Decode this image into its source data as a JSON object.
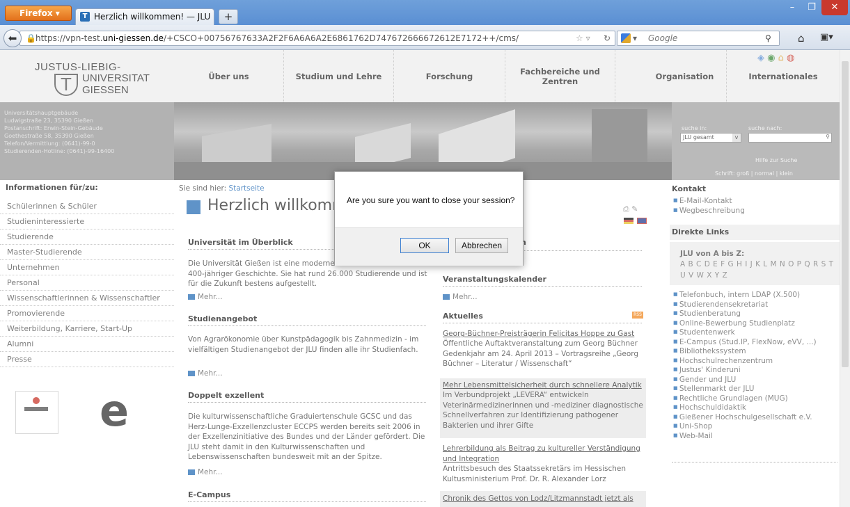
{
  "browser": {
    "menu_label": "Firefox",
    "tab_title": "Herzlich willkommen! — JLU",
    "new_tab": "+",
    "url_prefix": "https://vpn-test.",
    "url_domain": "uni-giessen.de",
    "url_rest": "/+CSCO+00756767633A2F2F6A6A6A2E6861762D747672666672612E7172++/cms/",
    "search_engine": "Google",
    "search_placeholder": "Google"
  },
  "site": {
    "logo_line1": "JUSTUS-LIEBIG-",
    "logo_line2": "UNIVERSITAT",
    "logo_line3": "GIESSEN",
    "nav": [
      "Über uns",
      "Studium und Lehre",
      "Forschung",
      "Fachbereiche und Zentren",
      "Organisation",
      "Internationales"
    ],
    "address": [
      "Universitätshauptgebäude",
      "Ludwigstraße 23, 35390 Gießen",
      "Postanschrift: Erwin-Stein-Gebäude",
      "Goethestraße 58, 35390 Gießen",
      "Telefon/Vermittlung: (0641)-99-0",
      "Studierenden-Hotline: (0641)-99-16400"
    ],
    "search": {
      "in_label": "suche in:",
      "after_label": "suche nach:",
      "scope": "JLU gesamt",
      "help": "Hilfe zur Suche",
      "font": "Schrift: groß | normal | klein"
    }
  },
  "left": {
    "heading": "Informationen für/zu:",
    "items": [
      "Schülerinnen & Schüler",
      "Studieninteressierte",
      "Studierende",
      "Master-Studierende",
      "Unternehmen",
      "Personal",
      "Wissenschaftlerinnen & Wissenschaftler",
      "Promovierende",
      "Weiterbildung, Karriere, Start-Up",
      "Alumni",
      "Presse"
    ]
  },
  "main": {
    "breadcrumb_prefix": "Sie sind hier:",
    "breadcrumb_link": "Startseite",
    "title": "Herzlich willkommen",
    "mehr": "Mehr...",
    "sections": [
      {
        "title": "Universität im Überblick",
        "text": "Die Universität Gießen ist eine moderne Hochschule mit über 400-jähriger Geschichte. Sie hat rund 26.000 Studierende und ist für die Zukunft bestens aufgestellt."
      },
      {
        "title": "Studienangebot",
        "text": "Von Agrarökonomie über Kunstpädagogik bis Zahnmedizin - im vielfältigen Studienangebot der JLU finden alle ihr Studienfach."
      },
      {
        "title": "Doppelt exzellent",
        "text": "Die kulturwissenschaftliche Graduiertenschule GCSC und das Herz-Lunge-Exzellenzcluster ECCPS werden bereits seit 2006 in der Exzellenzinitiative des Bundes und der Länder gefördert. Die JLU steht damit in den Kulturwissenschaften und Lebenswissenschaften bundesweit mit an der Spitze."
      },
      {
        "title": "E-Campus"
      }
    ]
  },
  "middle": {
    "partial_heading": "n",
    "calendar_title": "Veranstaltungskalender",
    "news_title": "Aktuelles",
    "rss": "RSS",
    "news": [
      {
        "link": "Georg-Büchner-Preisträgerin Felicitas Hoppe zu Gast",
        "text": "Öffentliche Auftaktveranstaltung zum Georg Büchner Gedenkjahr am 24. April 2013 – Vortragsreihe „Georg Büchner – Literatur / Wissenschaft“"
      },
      {
        "link": "Mehr Lebensmittelsicherheit durch schnellere Analytik",
        "text": "Im Verbundprojekt „LEVERA“ entwickeln Veterinärmedizinerinnen und -mediziner diagnostische Schnellverfahren zur Identifizierung pathogener Bakterien und ihrer Gifte"
      },
      {
        "link": "Lehrerbildung als Beitrag zu kultureller Verständigung und Integration",
        "text": "Antrittsbesuch des Staatssekretärs im Hessischen Kultusministerium Prof. Dr. R. Alexander Lorz"
      },
      {
        "link": "Chronik des Gettos von Lodz/Litzmannstadt jetzt als"
      }
    ]
  },
  "right": {
    "kontakt_title": "Kontakt",
    "kontakt_items": [
      "E-Mail-Kontakt",
      "Wegbeschreibung"
    ],
    "links_title": "Direkte Links",
    "az_title": "JLU von A bis Z:",
    "az_letters1": "A B C D E F G H I J K L M N O P Q R S T",
    "az_letters2": "U V W X Y Z",
    "links": [
      "Telefonbuch, intern LDAP (X.500)",
      "Studierendensekretariat",
      "Studienberatung",
      "Online-Bewerbung Studienplatz",
      "Studentenwerk",
      "E-Campus (Stud.IP, FlexNow, eVV, ...)",
      "Bibliothekssystem",
      "Hochschulrechenzentrum",
      "Justus' Kinderuni",
      "Gender und JLU",
      "Stellenmarkt der JLU",
      "Rechtliche Grundlagen (MUG)",
      "Hochschuldidaktik",
      "Gießener Hochschulgesellschaft e.V.",
      "Uni-Shop",
      "Web-Mail"
    ]
  },
  "dialog": {
    "message": "Are you sure you want to close your session?",
    "ok": "OK",
    "cancel": "Abbrechen"
  },
  "colors": {
    "accent": "#2a6fb6",
    "titlebar": "#5a8fd3",
    "close": "#c9392d"
  }
}
